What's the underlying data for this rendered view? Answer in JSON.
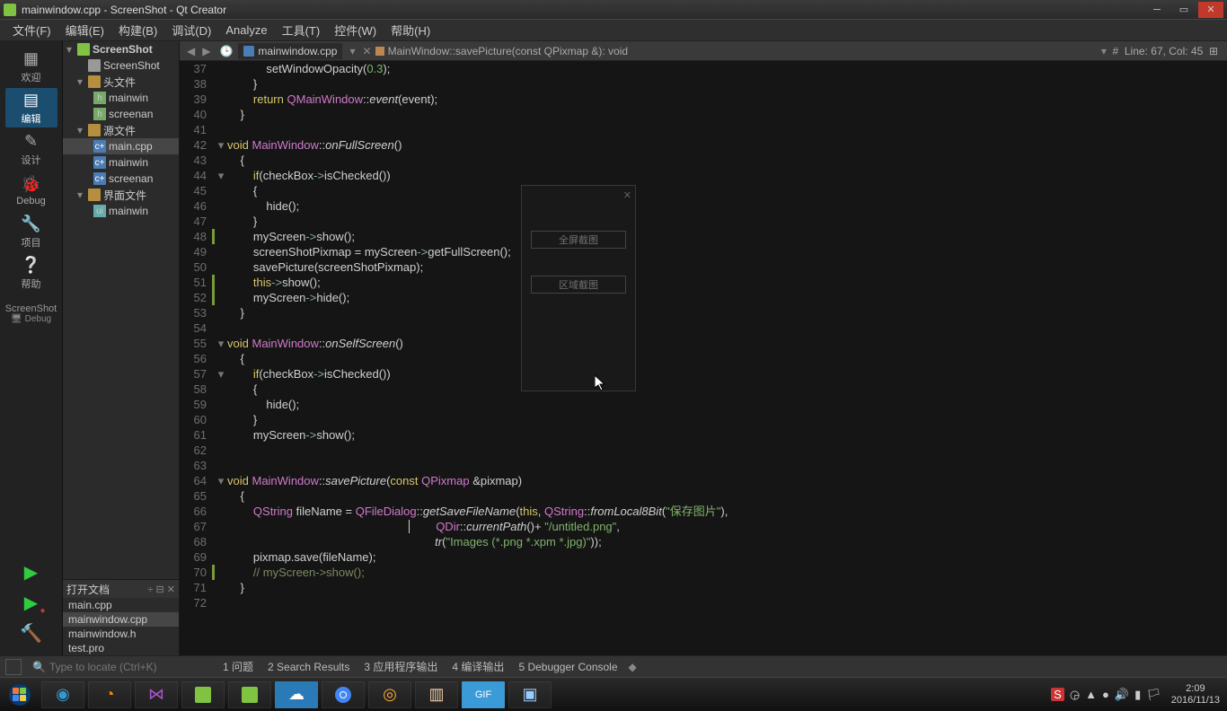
{
  "window": {
    "title": "mainwindow.cpp - ScreenShot - Qt Creator"
  },
  "menu": [
    "文件(F)",
    "编辑(E)",
    "构建(B)",
    "调试(D)",
    "Analyze",
    "工具(T)",
    "控件(W)",
    "帮助(H)"
  ],
  "modes": {
    "welcome": "欢迎",
    "edit": "编辑",
    "design": "设计",
    "debug": "Debug",
    "project": "项目",
    "help": "帮助"
  },
  "kit": {
    "name": "ScreenShot",
    "config": "Debug"
  },
  "tree": {
    "root": "ScreenShot",
    "pro": "ScreenShot",
    "headers": "头文件",
    "h1": "mainwin",
    "h2": "screenan",
    "sources": "源文件",
    "s1": "main.cpp",
    "s2": "mainwin",
    "s3": "screenan",
    "forms": "界面文件",
    "f1": "mainwin"
  },
  "opendocs": {
    "title": "打开文档",
    "d1": "main.cpp",
    "d2": "mainwindow.cpp",
    "d3": "mainwindow.h",
    "d4": "test.pro"
  },
  "editor": {
    "tab": "mainwindow.cpp",
    "crumb": "MainWindow::savePicture(const QPixmap &): void",
    "pos": "Line: 67, Col: 45"
  },
  "bottom": {
    "locate": "Type to locate (Ctrl+K)",
    "t1": "1  问题",
    "t2": "2  Search Results",
    "t3": "3  应用程序输出",
    "t4": "4  编译输出",
    "t5": "5  Debugger Console"
  },
  "ghost": {
    "b1": "全屏截图",
    "b2": "区域截图"
  },
  "tray": {
    "time": "2:09",
    "date": "2016/11/13",
    "ime": "S"
  }
}
